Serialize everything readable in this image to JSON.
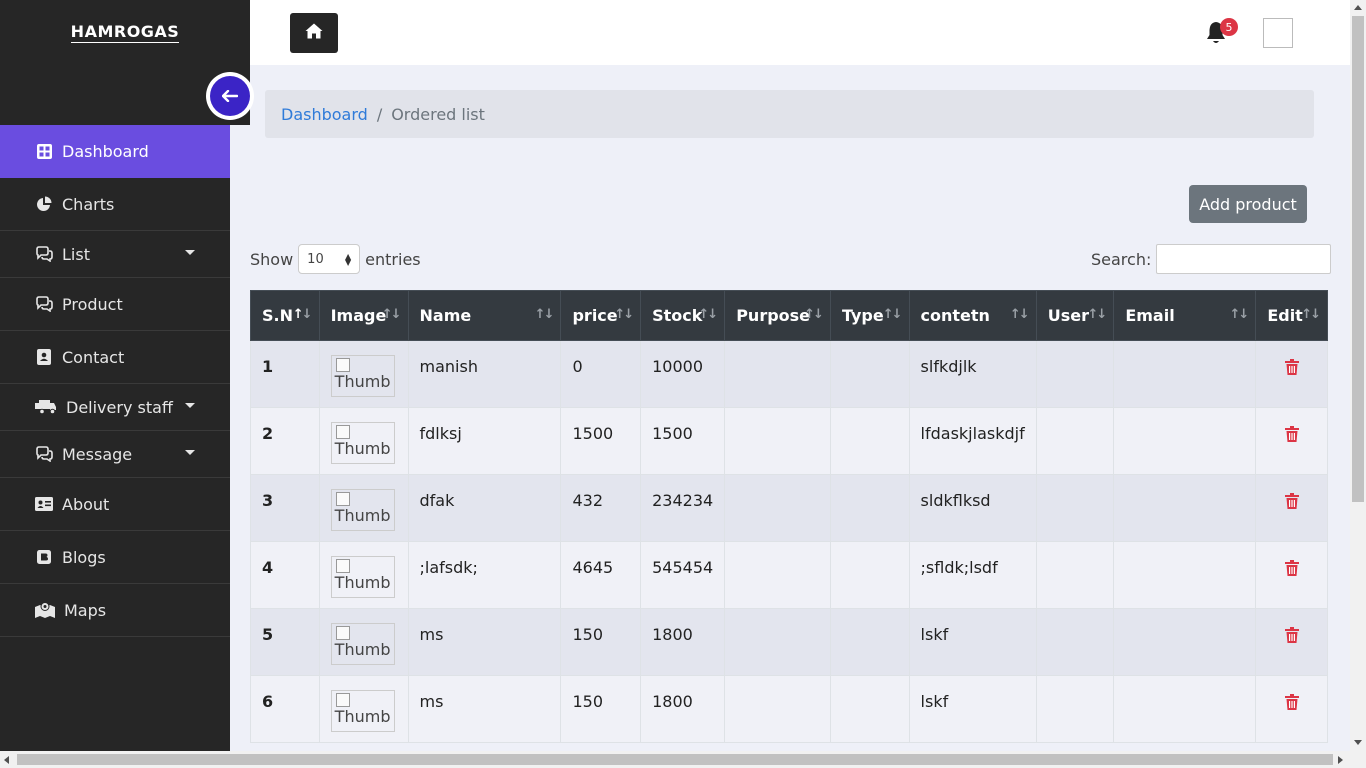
{
  "brand": "HAMROGAS",
  "header": {
    "notification_count": "5"
  },
  "sidebar": {
    "items": [
      {
        "label": "Dashboard",
        "icon": "grid-icon",
        "active": true
      },
      {
        "label": "Charts",
        "icon": "pie-chart-icon"
      },
      {
        "label": "List",
        "icon": "chat-icon",
        "caret": true
      },
      {
        "label": "Product",
        "icon": "chat-icon"
      },
      {
        "label": "Contact",
        "icon": "address-book-icon"
      },
      {
        "label": "Delivery staff",
        "icon": "truck-icon",
        "caret": true
      },
      {
        "label": "Message",
        "icon": "chat-icon",
        "caret": true
      },
      {
        "label": "About",
        "icon": "id-card-icon"
      },
      {
        "label": "Blogs",
        "icon": "blog-icon"
      },
      {
        "label": "Maps",
        "icon": "map-icon"
      }
    ]
  },
  "breadcrumb": {
    "link": "Dashboard",
    "separator": "/",
    "current": "Ordered list"
  },
  "actions": {
    "add_product": "Add product"
  },
  "table_controls": {
    "show_label": "Show",
    "entries_value": "10",
    "entries_label": "entries",
    "search_label": "Search:"
  },
  "table": {
    "headers": [
      "S.N",
      "Image",
      "Name",
      "price",
      "Stock",
      "Purpose",
      "Type",
      "contetn",
      "User",
      "Email",
      "Edit"
    ],
    "image_alt": "Thumb",
    "rows": [
      {
        "sn": "1",
        "name": "manish",
        "price": "0",
        "stock": "10000",
        "purpose": "",
        "type": "",
        "content": "slfkdjlk",
        "user": "",
        "email": ""
      },
      {
        "sn": "2",
        "name": "fdlksj",
        "price": "1500",
        "stock": "1500",
        "purpose": "",
        "type": "",
        "content": "lfdaskjlaskdjf",
        "user": "",
        "email": ""
      },
      {
        "sn": "3",
        "name": "dfak",
        "price": "432",
        "stock": "234234",
        "purpose": "",
        "type": "",
        "content": "sldkflksd",
        "user": "",
        "email": ""
      },
      {
        "sn": "4",
        "name": ";lafsdk;",
        "price": "4645",
        "stock": "545454",
        "purpose": "",
        "type": "",
        "content": ";sfldk;lsdf",
        "user": "",
        "email": ""
      },
      {
        "sn": "5",
        "name": "ms",
        "price": "150",
        "stock": "1800",
        "purpose": "",
        "type": "",
        "content": "lskf",
        "user": "",
        "email": ""
      },
      {
        "sn": "6",
        "name": "ms",
        "price": "150",
        "stock": "1800",
        "purpose": "",
        "type": "",
        "content": "lskf",
        "user": "",
        "email": ""
      }
    ]
  },
  "colors": {
    "sidebar_bg": "#262626",
    "active_item": "#6a4de0",
    "collapse_button": "#3b24c6",
    "delete_icon": "#dc3545",
    "table_header": "#343a40"
  }
}
